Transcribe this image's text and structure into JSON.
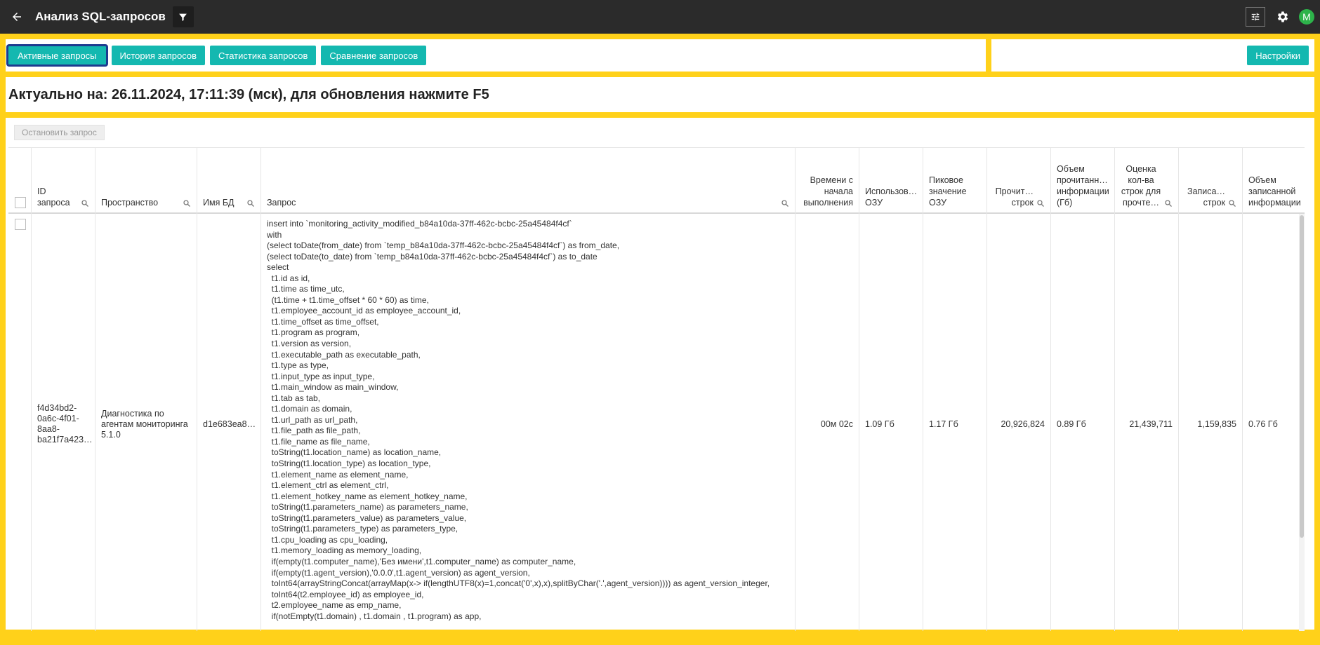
{
  "app": {
    "title": "Анализ SQL-запросов",
    "avatar_letter": "M",
    "avatar_color": "#2db34a"
  },
  "tabs": [
    {
      "label": "Активные запросы",
      "active": true
    },
    {
      "label": "История запросов",
      "active": false
    },
    {
      "label": "Статистика запросов",
      "active": false
    },
    {
      "label": "Сравнение запросов",
      "active": false
    }
  ],
  "settings_label": "Настройки",
  "status": "Актуально на: 26.11.2024, 17:11:39 (мск), для обновления нажмите F5",
  "toolbar": {
    "stop_label": "Остановить запрос"
  },
  "columns": {
    "id": "ID запроса",
    "space": "Пространство",
    "db": "Имя БД",
    "query": "Запрос",
    "elapsed": "Времени с начала выполнения",
    "ram": "Использов… ОЗУ",
    "peak": "Пиковое значение ОЗУ",
    "read_rows": "Прочит… строк",
    "read_volume": "Объем прочитанн… информации (Гб)",
    "est_rows": "Оценка кол-ва строк для прочте…",
    "written_rows": "Записа… строк",
    "written_volume": "Объем записанной информации"
  },
  "rows": [
    {
      "id": "f4d34bd2-0a6c-4f01-8aa8-ba21f7a423…",
      "space": "Диагностика по агентам мониторинга 5.1.0",
      "db": "d1e683ea8…",
      "query": "insert into `monitoring_activity_modified_b84a10da-37ff-462c-bcbc-25a45484f4cf`\nwith\n(select toDate(from_date) from `temp_b84a10da-37ff-462c-bcbc-25a45484f4cf`) as from_date,\n(select toDate(to_date) from `temp_b84a10da-37ff-462c-bcbc-25a45484f4cf`) as to_date\nselect\n  t1.id as id,\n  t1.time as time_utc,\n  (t1.time + t1.time_offset * 60 * 60) as time,\n  t1.employee_account_id as employee_account_id,\n  t1.time_offset as time_offset,\n  t1.program as program,\n  t1.version as version,\n  t1.executable_path as executable_path,\n  t1.type as type,\n  t1.input_type as input_type,\n  t1.main_window as main_window,\n  t1.tab as tab,\n  t1.domain as domain,\n  t1.url_path as url_path,\n  t1.file_path as file_path,\n  t1.file_name as file_name,\n  toString(t1.location_name) as location_name,\n  toString(t1.location_type) as location_type,\n  t1.element_name as element_name,\n  t1.element_ctrl as element_ctrl,\n  t1.element_hotkey_name as element_hotkey_name,\n  toString(t1.parameters_name) as parameters_name,\n  toString(t1.parameters_value) as parameters_value,\n  toString(t1.parameters_type) as parameters_type,\n  t1.cpu_loading as cpu_loading,\n  t1.memory_loading as memory_loading,\n  if(empty(t1.computer_name),'Без имени',t1.computer_name) as computer_name,\n  if(empty(t1.agent_version),'0.0.0',t1.agent_version) as agent_version,\n  toInt64(arrayStringConcat(arrayMap(x-> if(lengthUTF8(x)=1,concat('0',x),x),splitByChar('.',agent_version)))) as agent_version_integer,\n  toInt64(t2.employee_id) as employee_id,\n  t2.employee_name as emp_name,\n  if(notEmpty(t1.domain) , t1.domain , t1.program) as app,",
      "elapsed": "00м 02с",
      "ram": "1.09 Гб",
      "peak": "1.17 Гб",
      "read_rows": "20,926,824",
      "read_volume": "0.89 Гб",
      "est_rows": "21,439,711",
      "written_rows": "1,159,835",
      "written_volume": "0.76 Гб"
    }
  ],
  "colors": {
    "frame": "#ffd11a",
    "topbar": "#2b2b2b",
    "accent": "#14b8b0",
    "active_outline": "#1d3b8f"
  },
  "icons": [
    "back-arrow-icon",
    "filter-icon",
    "tune-icon",
    "gear-icon",
    "search-icon",
    "checkbox-icon"
  ]
}
